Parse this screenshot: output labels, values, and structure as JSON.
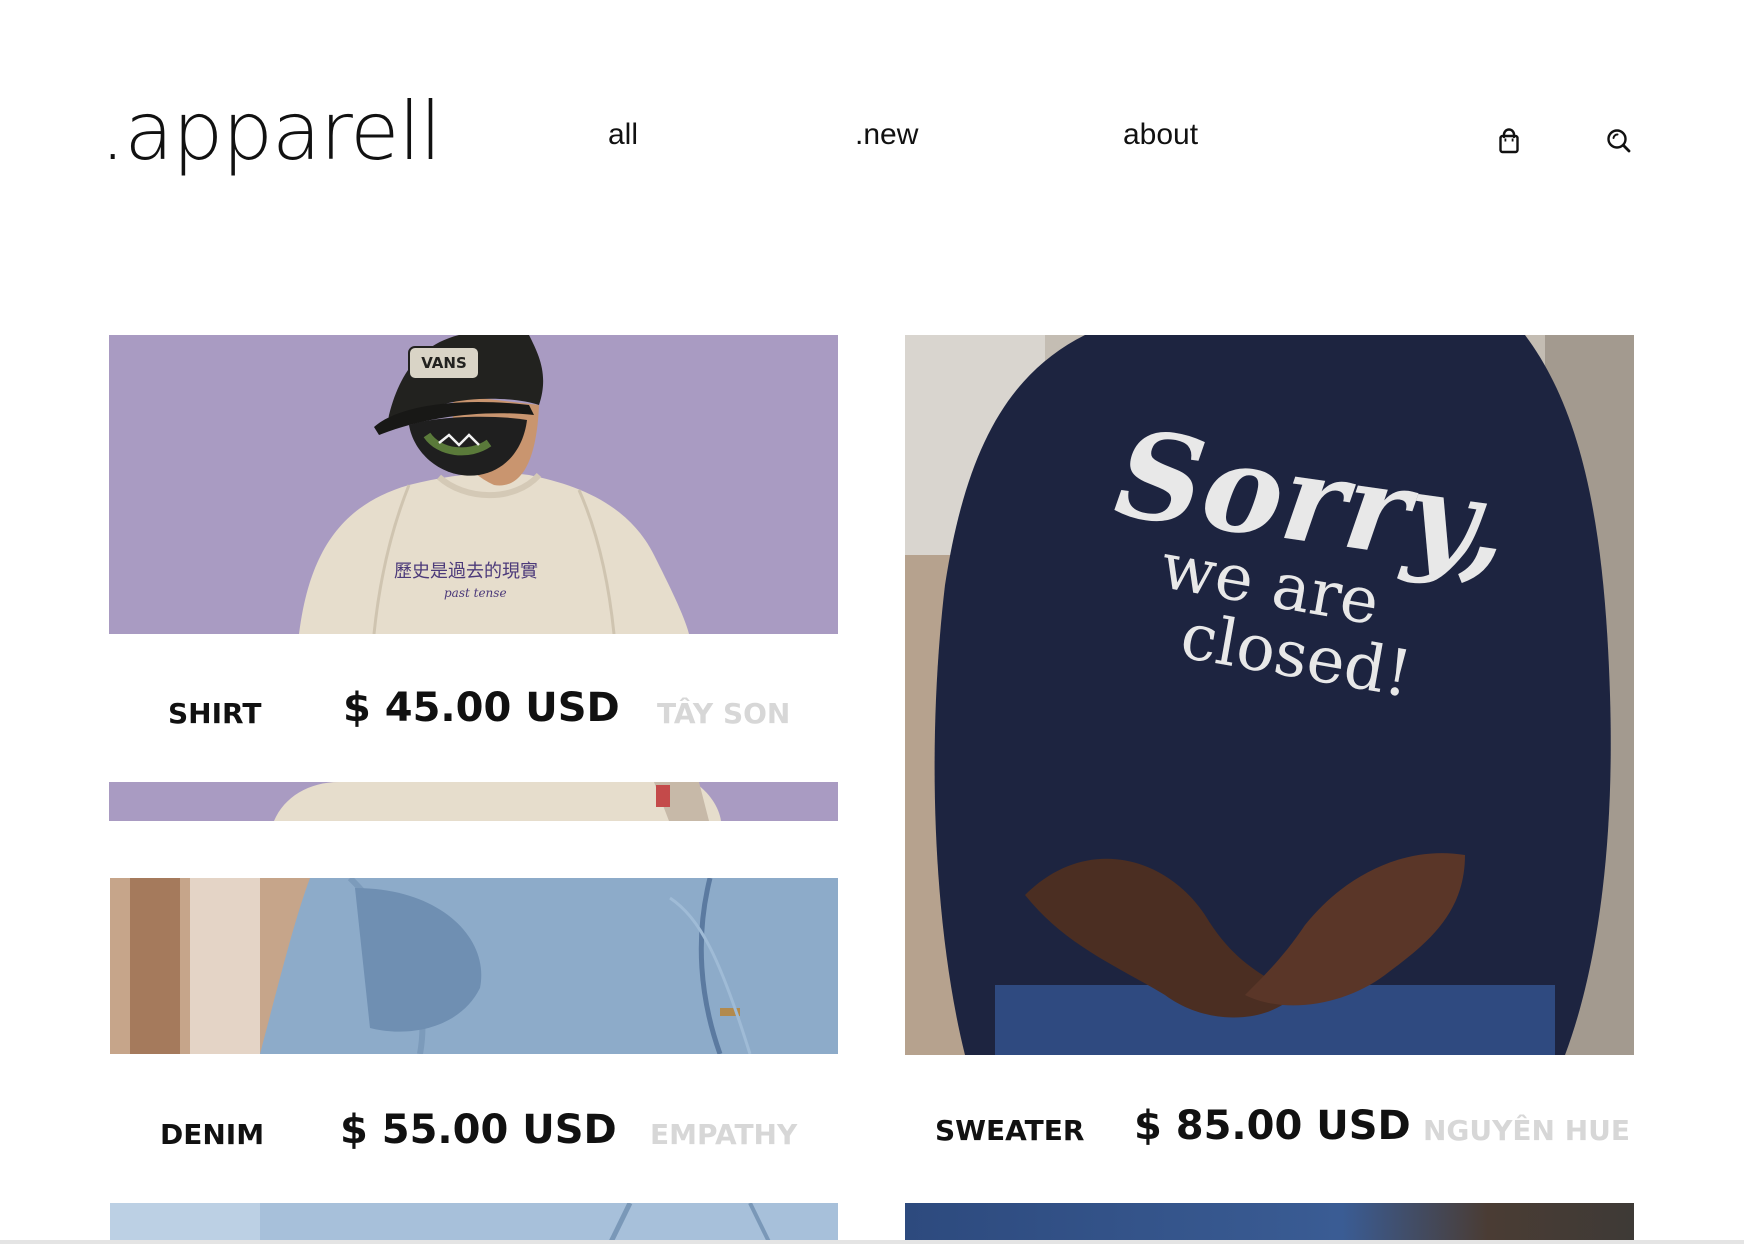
{
  "header": {
    "brand": ".apparell",
    "nav": {
      "all": "all",
      "new": ".new",
      "about": "about"
    },
    "icons": {
      "cart": "shopping-bag-icon",
      "search": "search-icon"
    }
  },
  "products": {
    "shirt": {
      "name": "SHIRT",
      "price": "$ 45.00 USD",
      "brand": "TÂY SON"
    },
    "denim": {
      "name": "DENIM",
      "price": "$ 55.00 USD",
      "brand": "EMPATHY"
    },
    "sweater": {
      "name": "SWEATER",
      "price": "$ 85.00 USD",
      "brand": "NGUYÊN HUE"
    }
  },
  "photo_text": {
    "cap": "VANS",
    "shirt_print": "歷史是過去的現實",
    "shirt_print_sub": "past tense",
    "sweater_line1": "Sorry,",
    "sweater_line2": "we are",
    "sweater_line3": "closed!"
  },
  "colors": {
    "text": "#111111",
    "muted_brand": "#d7d7d7",
    "lavender_bg": "#a99bc2",
    "navy_sweater": "#1d2440",
    "denim_blue": "#8aa8c6"
  }
}
